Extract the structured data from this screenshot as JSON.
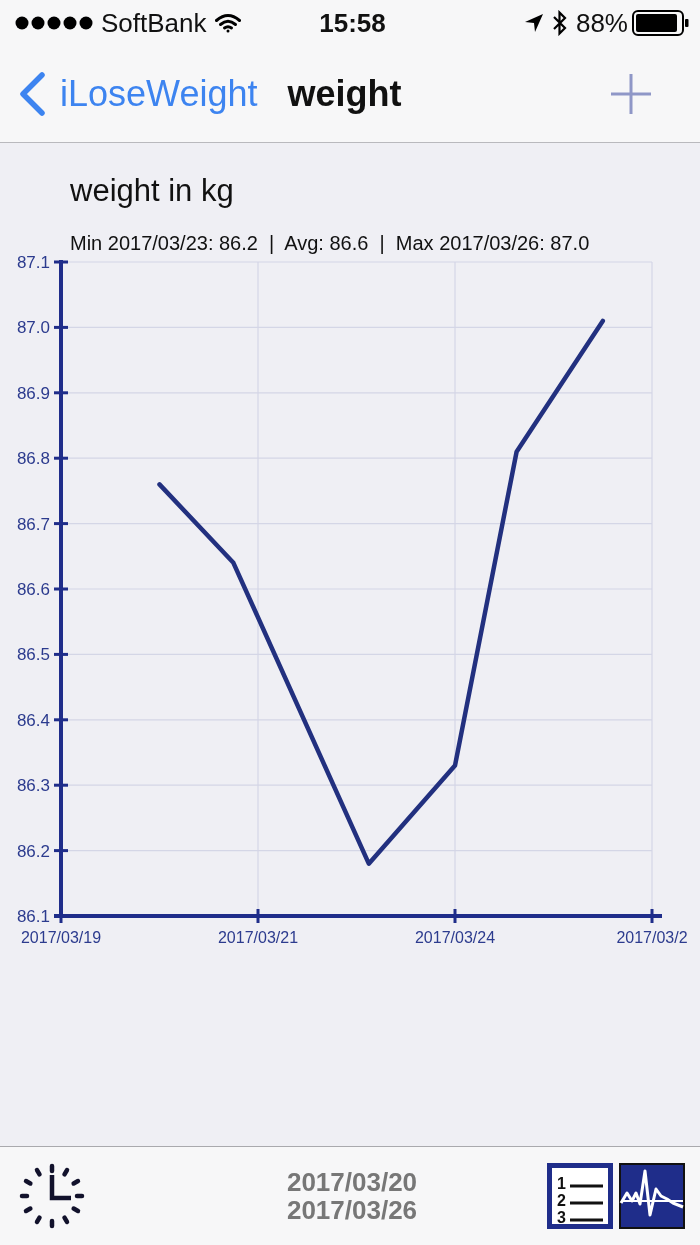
{
  "status_bar": {
    "carrier": "SoftBank",
    "time": "15:58",
    "battery": "88%"
  },
  "nav_bar": {
    "back": "iLoseWeight",
    "title": "weight"
  },
  "chart": {
    "summary": "Min 2017/03/23: 86.2  |  Avg: 86.6  |  Max 2017/03/26: 87.0",
    "chart_data": {
      "type": "line",
      "title": "weight in kg",
      "grid": true,
      "categories": [
        "2017/03/19",
        null,
        null,
        null,
        null,
        null,
        null,
        null,
        null,
        null,
        null,
        null,
        null,
        null,
        null,
        null,
        "2017/03/21",
        null,
        null,
        null,
        null,
        null,
        null,
        null,
        null,
        null,
        null,
        null,
        null,
        null,
        null,
        null,
        "2017/03/24",
        null,
        null,
        null,
        null,
        null,
        null,
        null,
        null,
        null,
        null,
        null,
        null,
        null,
        null,
        null,
        "2017/03/2"
      ],
      "series": [
        {
          "color": "#22307f",
          "values": [
            null,
            null,
            null,
            null,
            null,
            null,
            null,
            null,
            86.76,
            null,
            null,
            null,
            null,
            null,
            86.64,
            null,
            null,
            null,
            null,
            null,
            null,
            null,
            null,
            null,
            null,
            86.18,
            null,
            null,
            null,
            null,
            null,
            null,
            86.33,
            null,
            null,
            null,
            null,
            86.81,
            null,
            null,
            null,
            null,
            null,
            null,
            87.01,
            null,
            null,
            null,
            null
          ]
        }
      ],
      "ylim": [
        86.1,
        87.1
      ],
      "yticks": [
        {
          "value": 86.1,
          "label": "86.1"
        },
        {
          "value": 86.2,
          "label": "86.2"
        },
        {
          "value": 86.3,
          "label": "86.3"
        },
        {
          "value": 86.4,
          "label": "86.4"
        },
        {
          "value": 86.5,
          "label": "86.5"
        },
        {
          "value": 86.6,
          "label": "86.6"
        },
        {
          "value": 86.7,
          "label": "86.7"
        },
        {
          "value": 86.8,
          "label": "86.8"
        },
        {
          "value": 86.9,
          "label": "86.9"
        },
        {
          "value": 87.0,
          "label": "87.0"
        },
        {
          "value": 87.1,
          "label": "87.1"
        }
      ]
    }
  },
  "bottom_toolbar": {
    "dates": [
      "2017/03/20",
      "2017/03/26"
    ],
    "view_buttons": [
      {
        "kind": "list",
        "labels": [
          "1",
          "2",
          "3"
        ],
        "selected": false
      },
      {
        "kind": "chart",
        "selected": true
      }
    ]
  }
}
